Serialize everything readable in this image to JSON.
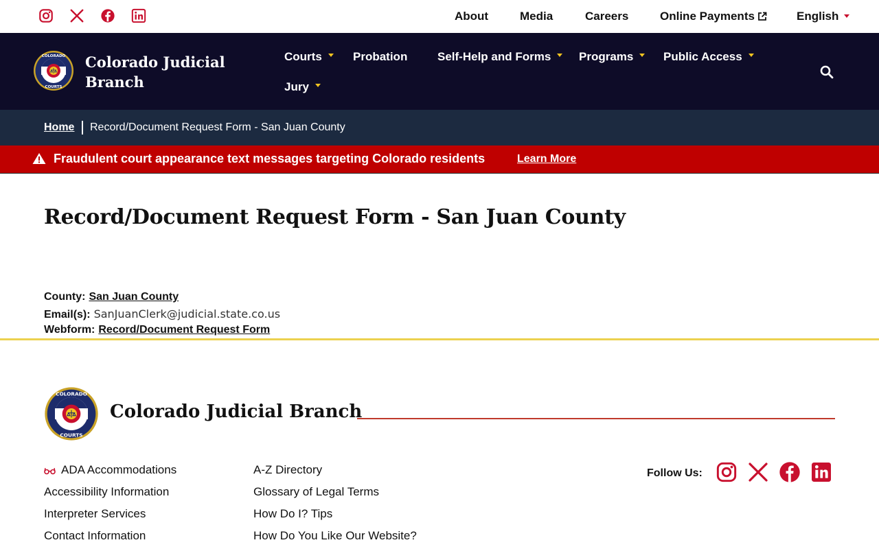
{
  "utility": {
    "social": [
      {
        "icon": "instagram-icon"
      },
      {
        "icon": "x-twitter-icon"
      },
      {
        "icon": "facebook-icon"
      },
      {
        "icon": "linkedin-icon"
      }
    ],
    "links": {
      "about": "About",
      "media": "Media",
      "careers": "Careers",
      "payments": "Online Payments",
      "language": "English"
    }
  },
  "header": {
    "brand_title": "Colorado Judicial Branch",
    "nav": {
      "courts": "Courts",
      "probation": "Probation",
      "selfhelp": "Self-Help and Forms",
      "programs": "Programs",
      "public_access": "Public Access",
      "jury": "Jury"
    }
  },
  "breadcrumb": {
    "home": "Home",
    "current": "Record/Document Request Form - San Juan County"
  },
  "alert": {
    "text": "Fraudulent court appearance text messages targeting Colorado residents",
    "link": "Learn More"
  },
  "main": {
    "title": "Record/Document Request Form - San Juan County",
    "county_label": "County:",
    "county_value": "San Juan County",
    "email_label": "Email(s):",
    "email_value": "SanJuanClerk@judicial.state.co.us",
    "webform_label": "Webform:",
    "webform_value": "Record/Document Request Form"
  },
  "footer": {
    "brand_title": "Colorado Judicial Branch",
    "col1": [
      "ADA Accommodations",
      "Accessibility Information",
      "Interpreter Services",
      "Contact Information"
    ],
    "col2": [
      "A-Z Directory",
      "Glossary of Legal Terms",
      "How Do I? Tips",
      "How Do You Like Our Website?"
    ],
    "follow_label": "Follow Us:"
  },
  "colors": {
    "navy": "#0e0c28",
    "breadcrumb": "#1c2a40",
    "alert_red": "#bf0000",
    "accent_red": "#c8102e",
    "gold": "#ecd150"
  }
}
